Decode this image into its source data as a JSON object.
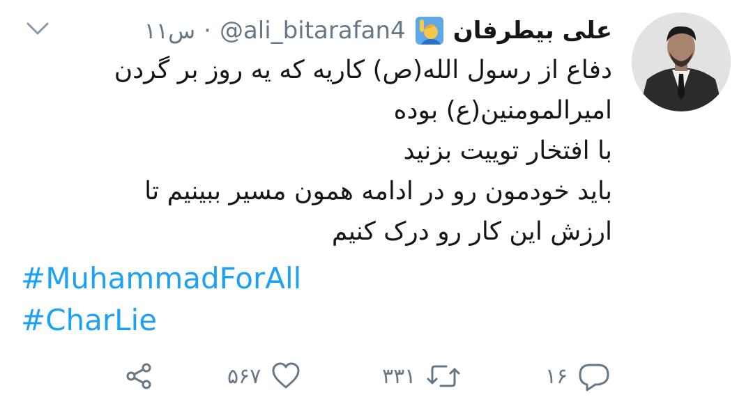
{
  "user": {
    "display_name": "علی بیطرفان",
    "handle": "@ali_bitarafan4",
    "separator": "·",
    "time": "۱۱س",
    "emoji_icon": "person-raising-hand-emoji"
  },
  "tweet": {
    "lines": [
      "دفاع از رسول الله(ص) کاریه که یه روز بر گردن",
      "امیرالمومنین(ع) بوده",
      "با افتخار توییت بزنید",
      "باید خودمون رو در ادامه همون مسیر ببینیم تا",
      "ارزش این کار رو درک کنیم"
    ],
    "hashtags": [
      "#MuhammadForAll",
      "#CharLie"
    ]
  },
  "actions": {
    "reply_count": "۱۶",
    "retweet_count": "۳۳۱",
    "like_count": "۵۶۷",
    "share_icon": "share-icon",
    "like_icon": "heart-icon",
    "retweet_icon": "retweet-icon",
    "reply_icon": "reply-icon"
  },
  "colors": {
    "hashtag": "#1da1f2",
    "secondary_text": "#657786",
    "primary_text": "#14171a"
  }
}
